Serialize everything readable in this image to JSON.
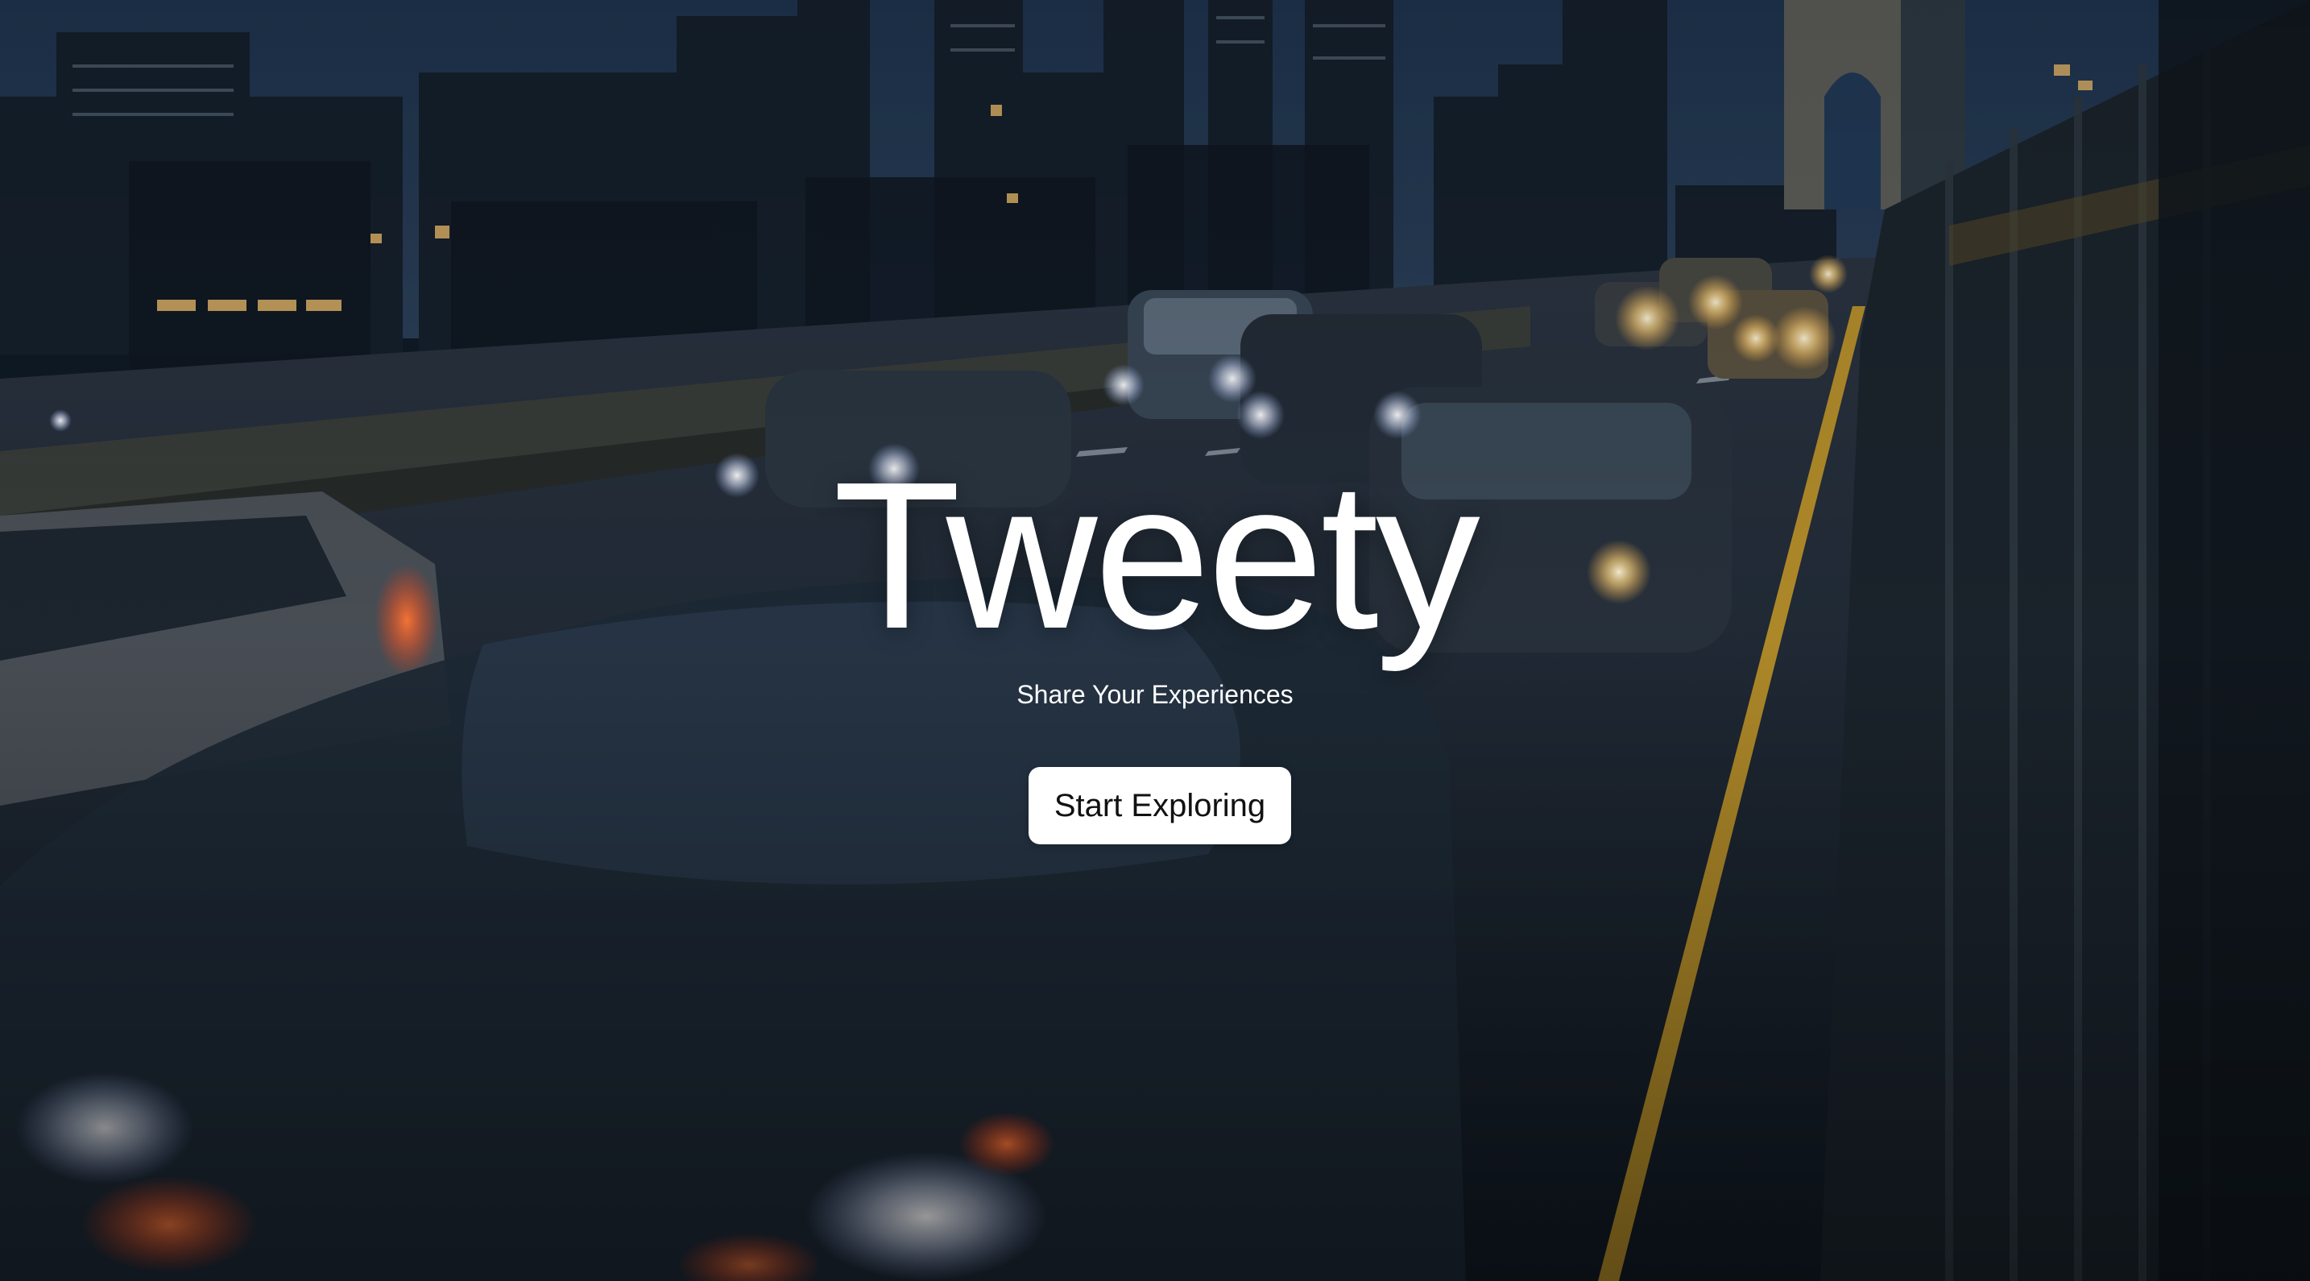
{
  "hero": {
    "title": "Tweety",
    "subtitle": "Share Your Experiences",
    "cta_label": "Start Exploring",
    "background": "night-traffic-bridge-photo"
  },
  "colors": {
    "title_text": "#ffffff",
    "button_bg": "#ffffff",
    "button_text": "#111111",
    "sky": "#1d3048",
    "road": "#1a2633"
  }
}
